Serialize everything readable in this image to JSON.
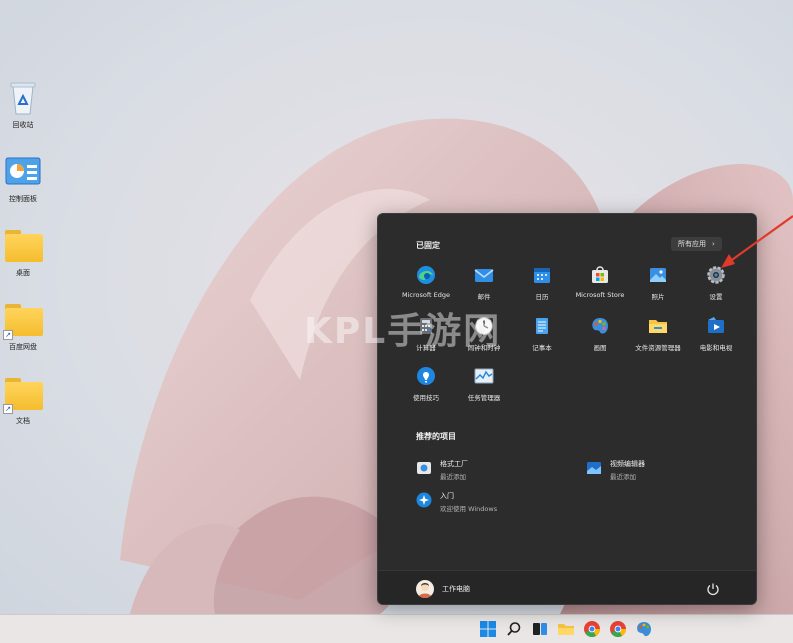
{
  "desktop": {
    "icons": [
      {
        "name": "recycle-bin",
        "label": "回收站"
      },
      {
        "name": "control-panel",
        "label": "控制面板"
      },
      {
        "name": "folder-1",
        "label": "桌面"
      },
      {
        "name": "folder-2",
        "label": "百度网盘"
      },
      {
        "name": "folder-3",
        "label": "文档"
      }
    ]
  },
  "watermark": "KPL手游网",
  "start_menu": {
    "pinned_heading": "已固定",
    "all_apps_label": "所有应用",
    "all_apps_chevron": "›",
    "pinned": [
      {
        "label": "Microsoft Edge",
        "icon": "edge-icon"
      },
      {
        "label": "邮件",
        "icon": "mail-icon"
      },
      {
        "label": "日历",
        "icon": "calendar-icon"
      },
      {
        "label": "Microsoft Store",
        "icon": "store-icon"
      },
      {
        "label": "照片",
        "icon": "photos-icon"
      },
      {
        "label": "设置",
        "icon": "gear-icon"
      },
      {
        "label": "计算器",
        "icon": "calculator-icon"
      },
      {
        "label": "闹钟和时钟",
        "icon": "clock-icon"
      },
      {
        "label": "记事本",
        "icon": "notepad-icon"
      },
      {
        "label": "画图",
        "icon": "paint-icon"
      },
      {
        "label": "文件资源管理器",
        "icon": "file-explorer-icon"
      },
      {
        "label": "电影和电视",
        "icon": "movies-tv-icon"
      },
      {
        "label": "使用技巧",
        "icon": "tips-icon"
      },
      {
        "label": "任务管理器",
        "icon": "task-manager-icon"
      }
    ],
    "recommended_heading": "推荐的项目",
    "recommended": [
      {
        "title": "格式工厂",
        "subtitle": "最近添加",
        "icon": "format-factory-icon"
      },
      {
        "title": "视频编辑器",
        "subtitle": "最近添加",
        "icon": "video-editor-icon"
      },
      {
        "title": "入门",
        "subtitle": "欢迎使用 Windows",
        "icon": "get-started-icon"
      }
    ],
    "user_name": "工作电脑"
  },
  "colors": {
    "accent": "#0078d4",
    "menu_bg": "#2c2c2c",
    "arrow": "#e03a2c"
  }
}
